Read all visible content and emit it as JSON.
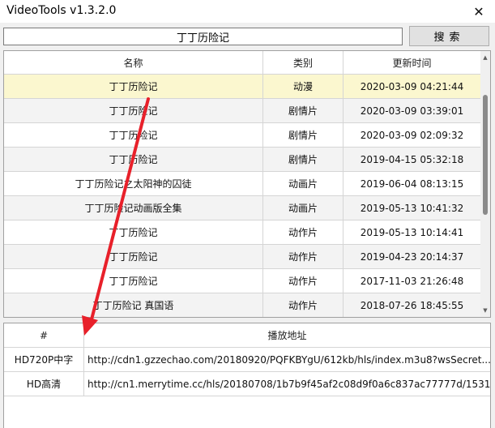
{
  "window": {
    "title": "VideoTools v1.3.2.0",
    "close_glyph": "✕"
  },
  "search": {
    "value": "丁丁历险记",
    "button_label": "搜索"
  },
  "results": {
    "columns": [
      "名称",
      "类别",
      "更新时间"
    ],
    "rows": [
      {
        "name": "丁丁历险记",
        "category": "动漫",
        "time": "2020-03-09 04:21:44"
      },
      {
        "name": "丁丁历险记",
        "category": "剧情片",
        "time": "2020-03-09 03:39:01"
      },
      {
        "name": "丁丁历险记",
        "category": "剧情片",
        "time": "2020-03-09 02:09:32"
      },
      {
        "name": "丁丁历险记",
        "category": "剧情片",
        "time": "2019-04-15 05:32:18"
      },
      {
        "name": "丁丁历险记之太阳神的囚徒",
        "category": "动画片",
        "time": "2019-06-04 08:13:15"
      },
      {
        "name": "丁丁历险记动画版全集",
        "category": "动画片",
        "time": "2019-05-13 10:41:32"
      },
      {
        "name": "丁丁历险记",
        "category": "动作片",
        "time": "2019-05-13 10:14:41"
      },
      {
        "name": "丁丁历险记",
        "category": "动作片",
        "time": "2019-04-23 20:14:37"
      },
      {
        "name": "丁丁历险记",
        "category": "动作片",
        "time": "2017-11-03 21:26:48"
      },
      {
        "name": "丁丁历险记 真国语",
        "category": "动作片",
        "time": "2018-07-26 18:45:55"
      }
    ],
    "selected_index": 0
  },
  "urls": {
    "columns": [
      "#",
      "播放地址"
    ],
    "rows": [
      {
        "label": "HD720P中字",
        "url": "http://cdn1.gzzechao.com/20180920/PQFKBYgU/612kb/hls/index.m3u8?wsSecret..."
      },
      {
        "label": "HD高清",
        "url": "http://cn1.merrytime.cc/hls/20180708/1b7b9f45af2c08d9f0a6c837ac77777d/1531..."
      }
    ]
  },
  "colors": {
    "selected_row": "#fbf7cf",
    "alt_row": "#f3f3f3",
    "annotation": "#e8202a"
  },
  "icons": {
    "close": "close-icon",
    "scroll_up": "scroll-up-arrow-icon",
    "scroll_down": "scroll-down-arrow-icon"
  }
}
